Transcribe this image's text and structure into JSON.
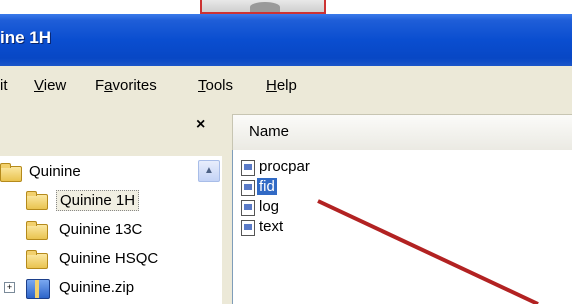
{
  "window": {
    "title": "ine 1H"
  },
  "menu": {
    "items": [
      {
        "pre": "it",
        "u": "",
        "post": ""
      },
      {
        "pre": "",
        "u": "V",
        "post": "iew"
      },
      {
        "pre": "F",
        "u": "a",
        "post": "vorites"
      },
      {
        "pre": "",
        "u": "T",
        "post": "ools"
      },
      {
        "pre": "",
        "u": "H",
        "post": "elp"
      }
    ]
  },
  "folders_pane": {
    "close_glyph": "×",
    "scroll_glyph": "▲",
    "expander_glyph": "+",
    "items": [
      {
        "label": "Quinine"
      },
      {
        "label": "Quinine 1H"
      },
      {
        "label": "Quinine 13C"
      },
      {
        "label": "Quinine HSQC"
      },
      {
        "label": "Quinine.zip"
      }
    ]
  },
  "file_list": {
    "column_header": "Name",
    "files": [
      {
        "label": "procpar"
      },
      {
        "label": "fid"
      },
      {
        "label": "log"
      },
      {
        "label": "text"
      }
    ]
  },
  "colors": {
    "titlebar": "#0a4ed0",
    "selection": "#316ac5",
    "arrow": "#b22222"
  }
}
